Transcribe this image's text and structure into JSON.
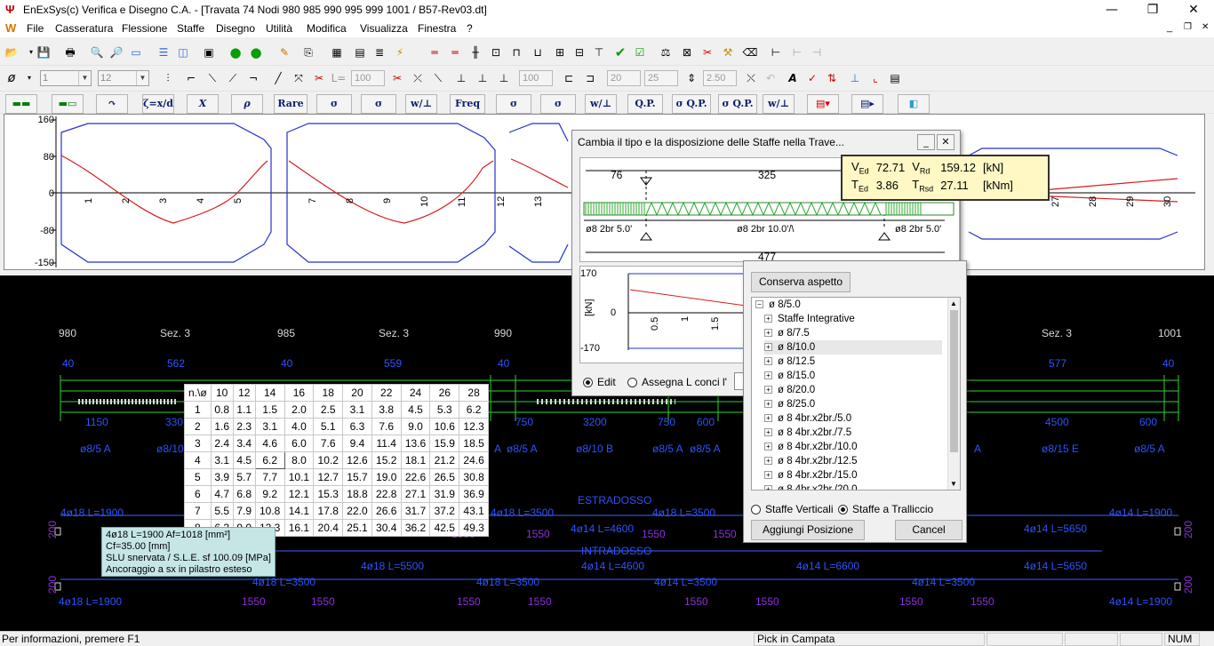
{
  "title": "EnExSys(c) Verifica e Disegno C.A. - [Travata 74 Nodi 980 985 990 995 999 1001 / B57-Rev03.dt]",
  "menu": [
    "File",
    "Casseratura",
    "Flessione",
    "Staffe",
    "Disegno",
    "Utilità",
    "Modifica",
    "Visualizza",
    "Finestra",
    "?"
  ],
  "toolbar2": {
    "combo1": "1",
    "combo2": "12",
    "field_l": "L=",
    "field_100a": "100",
    "field_100b": "100",
    "field_20": "20",
    "field_25": "25",
    "field_250": "2.50",
    "symbol": "ø"
  },
  "toolbar3": [
    "Rare",
    "σ Rare",
    "σ Rare",
    "Freq",
    "σ Freq",
    "σ Freq",
    "Q.P.",
    "σ Q.P.",
    "σ Q.P."
  ],
  "chart": {
    "y_ticks": [
      "160",
      "80",
      "0",
      "-80",
      "-150"
    ],
    "x_ticks": [
      "1",
      "2",
      "3",
      "4",
      "5",
      "7",
      "8",
      "9",
      "10",
      "11",
      "12",
      "13",
      "27",
      "28",
      "29",
      "30"
    ]
  },
  "drawing": {
    "nodes": [
      "980",
      "Sez. 3",
      "985",
      "Sez. 3",
      "990",
      "Sez. 3",
      "1001"
    ],
    "top_dims": [
      "40",
      "562",
      "40",
      "559",
      "40",
      "577",
      "40"
    ],
    "stirrup_dims": [
      "1150",
      "330",
      "750",
      "3200",
      "750",
      "600",
      "4500",
      "600"
    ],
    "stirrups": [
      "ø8/5 A",
      "ø8/10",
      "A",
      "ø8/5 A",
      "ø8/10 B",
      "ø8/5 A",
      "ø8/5 A",
      "A",
      "ø8/15 E",
      "ø8/5 A"
    ],
    "estradosso": "ESTRADOSSO",
    "intradosso": "INTRADOSSO",
    "top_bars": [
      "4ø18 L=1900",
      "4ø18 L=3500",
      "4ø18 L=3500",
      "4ø14 L=1900",
      "4ø14 L=4600",
      "4ø14 L=5650"
    ],
    "mid_bars": [
      "4ø18 L=5500",
      "4ø14 L=4600",
      "4ø14 L=6600",
      "4ø14 L=5650",
      "1550",
      "1550",
      "1550",
      "1550"
    ],
    "bot_bars": [
      "4ø18 L=1900",
      "4ø18 L=3500",
      "4ø18 L=3500",
      "4ø14 L=3500",
      "4ø14 L=3500",
      "4ø14 L=1900"
    ],
    "bot_dims": [
      "1550",
      "1550",
      "1550",
      "1550",
      "1550",
      "1550",
      "1550",
      "1550"
    ],
    "heights": [
      "200",
      "200",
      "200",
      "200"
    ]
  },
  "bartable": {
    "header": [
      "n.\\ø",
      "10",
      "12",
      "14",
      "16",
      "18",
      "20",
      "22",
      "24",
      "26",
      "28"
    ],
    "rows": [
      [
        "1",
        "0.8",
        "1.1",
        "1.5",
        "2.0",
        "2.5",
        "3.1",
        "3.8",
        "4.5",
        "5.3",
        "6.2"
      ],
      [
        "2",
        "1.6",
        "2.3",
        "3.1",
        "4.0",
        "5.1",
        "6.3",
        "7.6",
        "9.0",
        "10.6",
        "12.3"
      ],
      [
        "3",
        "2.4",
        "3.4",
        "4.6",
        "6.0",
        "7.6",
        "9.4",
        "11.4",
        "13.6",
        "15.9",
        "18.5"
      ],
      [
        "4",
        "3.1",
        "4.5",
        "6.2",
        "8.0",
        "10.2",
        "12.6",
        "15.2",
        "18.1",
        "21.2",
        "24.6"
      ],
      [
        "5",
        "3.9",
        "5.7",
        "7.7",
        "10.1",
        "12.7",
        "15.7",
        "19.0",
        "22.6",
        "26.5",
        "30.8"
      ],
      [
        "6",
        "4.7",
        "6.8",
        "9.2",
        "12.1",
        "15.3",
        "18.8",
        "22.8",
        "27.1",
        "31.9",
        "36.9"
      ],
      [
        "7",
        "5.5",
        "7.9",
        "10.8",
        "14.1",
        "17.8",
        "22.0",
        "26.6",
        "31.7",
        "37.2",
        "43.1"
      ],
      [
        "8",
        "6.3",
        "9.0",
        "12.3",
        "16.1",
        "20.4",
        "25.1",
        "30.4",
        "36.2",
        "42.5",
        "49.3"
      ]
    ]
  },
  "infobox": {
    "line1": "4ø18 L=1900 Af=1018 [mm²]",
    "line2": "Cf=35.00 [mm]",
    "line3": "SLU   snervata / S.L.E. sf 100.09 [MPa]",
    "line4": "Ancoraggio a sx in pilastro esteso"
  },
  "dialog": {
    "title": "Cambia il tipo e la disposizione delle Staffe nella Trave...",
    "dim_left": "76",
    "dim_mid": "325",
    "dim_total": "477",
    "stirrup_left": "ø8 2br 5.0'",
    "stirrup_mid": "ø8 2br 10.0'/\\",
    "stirrup_right": "ø8 2br 5.0'",
    "y_top": "170",
    "y_zero": "0",
    "y_bot": "-170",
    "y_unit": "[kN]",
    "x_ticks": [
      "0.5",
      "1",
      "1.5"
    ],
    "radio_edit": "Edit",
    "radio_assign": "Assegna L conci l'"
  },
  "tooltip": {
    "ved_label": "V",
    "ved_sub": "Ed",
    "ved_val": "72.71",
    "vrd_label": "V",
    "vrd_sub": "Rd",
    "vrd_val": "159.12",
    "unit1": "[kN]",
    "ted_label": "T",
    "ted_sub": "Ed",
    "ted_val": "3.86",
    "trd_label": "T",
    "trd_sub": "Rsd",
    "trd_val": "27.11",
    "unit2": "[kNm]"
  },
  "tree": {
    "conserva": "Conserva aspetto",
    "root": "ø 8/5.0",
    "items": [
      "Staffe Integrative",
      "ø 8/7.5",
      "ø 8/10.0",
      "ø 8/12.5",
      "ø 8/15.0",
      "ø 8/20.0",
      "ø 8/25.0",
      "ø 8 4br.x2br./5.0",
      "ø 8 4br.x2br./7.5",
      "ø 8 4br.x2br./10.0",
      "ø 8 4br.x2br./12.5",
      "ø 8 4br.x2br./15.0",
      "ø 8 4br.x2br./20.0"
    ],
    "radio_vert": "Staffe Verticali",
    "radio_tral": "Staffe a Tralliccio",
    "btn_add": "Aggiungi Posizione",
    "btn_cancel": "Cancel"
  },
  "status": {
    "left": "Per informazioni, premere F1",
    "mid": "Pick in Campata",
    "num": "NUM"
  }
}
